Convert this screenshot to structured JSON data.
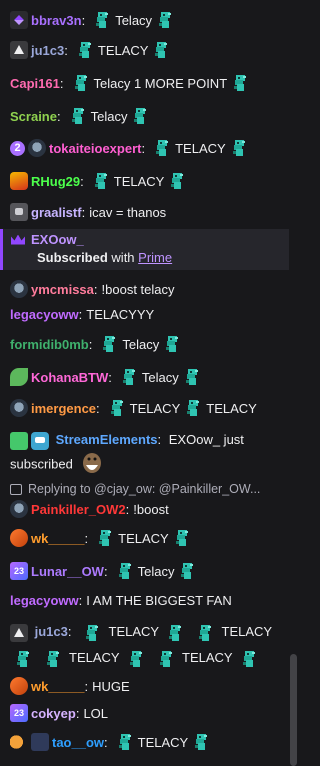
{
  "chat": {
    "m1": {
      "user": "bbrav3n",
      "color": "#a970ff",
      "text": "Telacy"
    },
    "m2": {
      "user": "ju1c3",
      "color": "#9aa7d9",
      "text": "TELACY"
    },
    "m3": {
      "user": "Capi161",
      "color": "#ff6bb0",
      "text": "Telacy 1 MORE POINT"
    },
    "m4": {
      "user": "Scraine",
      "color": "#8fd14f",
      "text": "Telacy"
    },
    "m5": {
      "user": "tokaiteioexpert",
      "color": "#ff5fd2",
      "badge_num": "2",
      "text": "TELACY"
    },
    "m6": {
      "user": "RHug29",
      "color": "#4cff4c",
      "text": "TELACY"
    },
    "m7": {
      "user": "graalistf",
      "color": "#c7b4ff",
      "text": "icav = thanos"
    },
    "sub": {
      "user": "EXOow_",
      "subscribed": "Subscribed",
      "with": "with",
      "tier": "Prime"
    },
    "m8": {
      "user": "ymcmissa",
      "color": "#ff7c9c",
      "text": "!boost telacy"
    },
    "m9": {
      "user": "legacyoww",
      "color": "#c06bff",
      "text": "TELACYYY"
    },
    "m10": {
      "user": "formidib0mb",
      "color": "#3fb06d",
      "text": "Telacy"
    },
    "m11": {
      "user": "KohanaBTW",
      "color": "#ff68d8",
      "text": "Telacy"
    },
    "m12": {
      "user": "imergence",
      "color": "#ff9a45",
      "text1": "TELACY",
      "text2": "TELACY"
    },
    "m13": {
      "user": "StreamElements",
      "color": "#5ea8ff",
      "text": "EXOow_ just subscribed"
    },
    "reply": {
      "text": "Replying to @cjay_ow: @Painkiller_OW..."
    },
    "m14": {
      "user": "Painkiller_OW2",
      "color": "#ff3838",
      "text": "!boost"
    },
    "m15": {
      "user": "wk_____",
      "color": "#ff9d2e",
      "text": "TELACY"
    },
    "m16": {
      "user": "Lunar__OW",
      "color": "#ad7bff",
      "text": "Telacy"
    },
    "m17": {
      "user": "legacyoww",
      "color": "#c06bff",
      "text": "I AM THE BIGGEST FAN"
    },
    "m18": {
      "user": "ju1c3",
      "color": "#9aa7d9",
      "t1": "TELACY",
      "t2": "TELACY",
      "t3": "TELACY",
      "t4": "TELACY"
    },
    "m19": {
      "user": "wk_____",
      "color": "#ff9d2e",
      "text": "HUGE"
    },
    "m20": {
      "user": "cokyep",
      "color": "#d6b3ff",
      "text": "LOL"
    },
    "m21": {
      "user": "tao__ow",
      "color": "#2e9fff",
      "text": "TELACY"
    }
  },
  "icons": [
    "sword-badge",
    "prime-badge",
    "avatar-badge",
    "emote-telacy",
    "crown-icon",
    "reply-icon",
    "bot-badge",
    "snake-emote"
  ]
}
